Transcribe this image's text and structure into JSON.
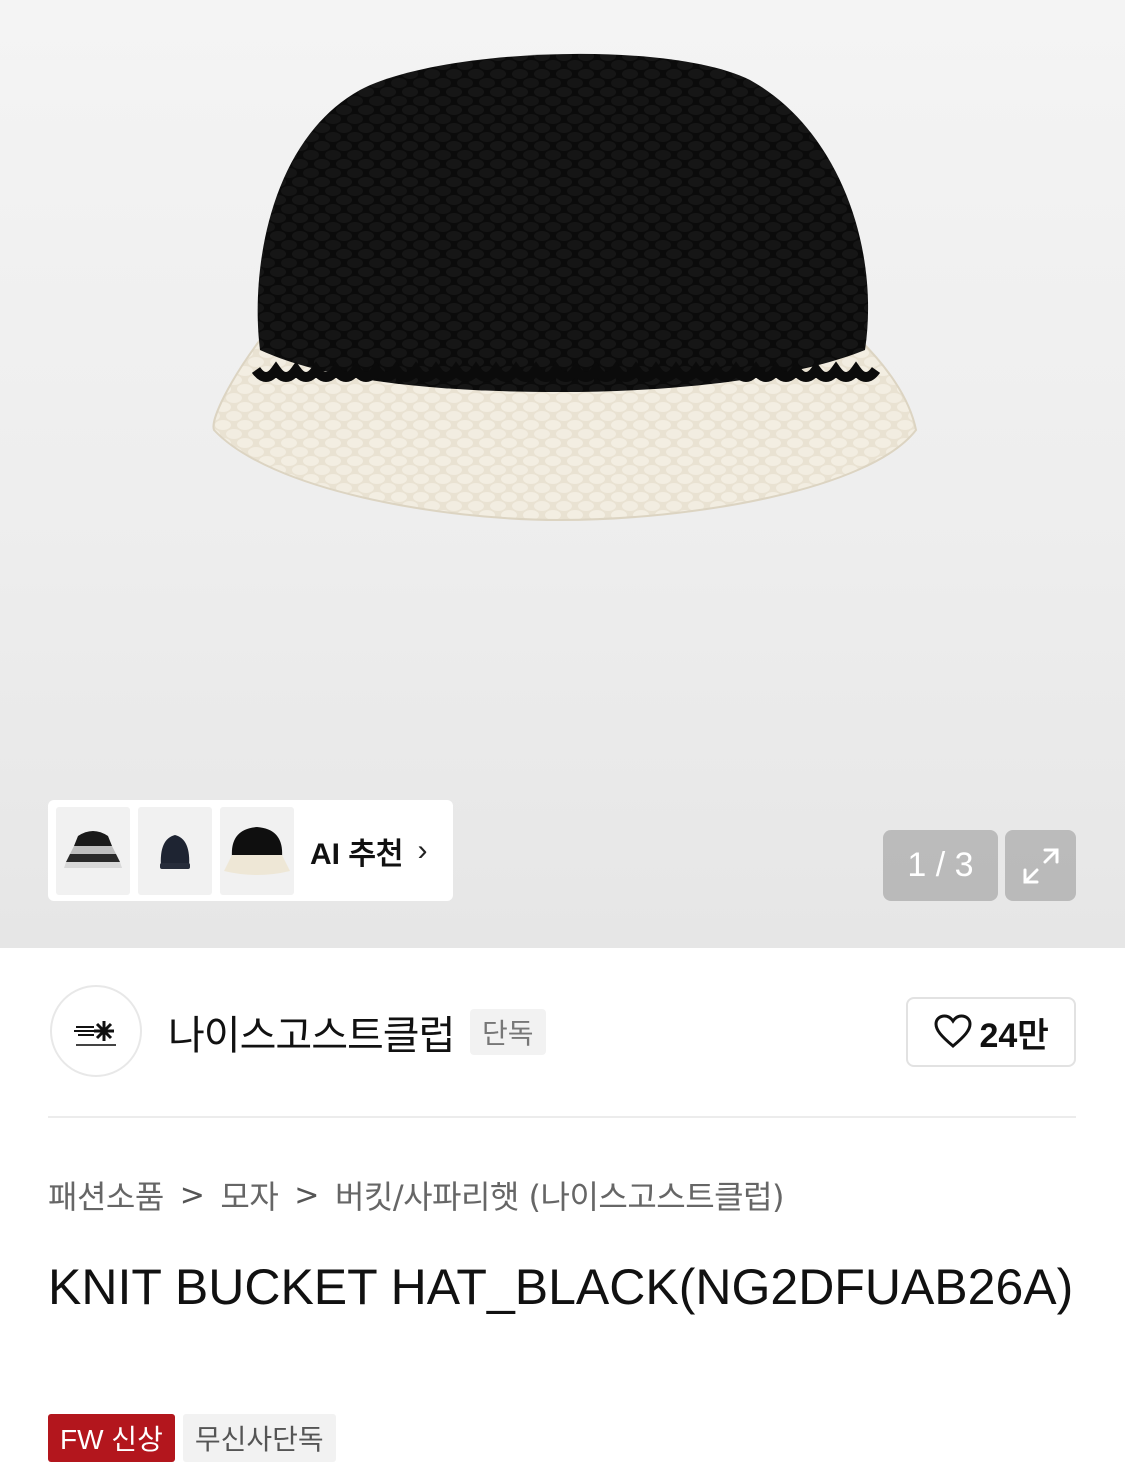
{
  "gallery": {
    "image_alt": "knit bucket hat black with cream brim",
    "ai_recommend_label": "AI 추천",
    "ai_chevron": "›",
    "counter": "1 / 3",
    "expand_icon": "expand-icon",
    "thumbnails": [
      "striped-bucket-hat",
      "navy-beanie",
      "black-cream-bucket-hat"
    ]
  },
  "brand": {
    "logo": "nice-ghost-club-logo",
    "name": "나이스고스트클럽",
    "exclusive_badge": "단독",
    "like_count": "24만"
  },
  "breadcrumb": {
    "items": [
      "패션소품",
      "모자",
      "버킷/사파리햇 (나이스고스트클럽)"
    ],
    "separator": ">"
  },
  "product": {
    "title": "KNIT BUCKET HAT_BLACK(NG2DFUAB26A)"
  },
  "tags": {
    "new_label": "FW 신상",
    "exclusive_label": "무신사단독"
  },
  "colors": {
    "accent_red": "#b3161d",
    "hat_black": "#0c0c0c",
    "hat_cream": "#efe9dc"
  }
}
